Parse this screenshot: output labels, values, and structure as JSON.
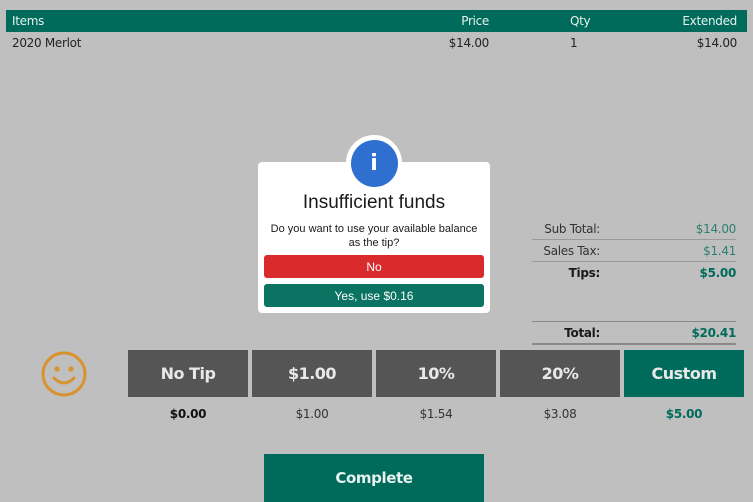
{
  "table": {
    "headers": {
      "items": "Items",
      "price": "Price",
      "qty": "Qty",
      "extended": "Extended"
    },
    "rows": [
      {
        "item": "2020 Merlot",
        "price": "$14.00",
        "qty": "1",
        "extended": "$14.00"
      }
    ]
  },
  "totals": {
    "sub_total_label": "Sub Total:",
    "sub_total": "$14.00",
    "sales_tax_label": "Sales Tax:",
    "sales_tax": "$1.41",
    "tips_label": "Tips:",
    "tips": "$5.00",
    "total_label": "Total:",
    "total": "$20.41"
  },
  "tip_options": [
    {
      "label": "No Tip",
      "amount": "$0.00"
    },
    {
      "label": "$1.00",
      "amount": "$1.00"
    },
    {
      "label": "10%",
      "amount": "$1.54"
    },
    {
      "label": "20%",
      "amount": "$3.08"
    },
    {
      "label": "Custom",
      "amount": "$5.00"
    }
  ],
  "complete_label": "Complete",
  "modal": {
    "icon": "i",
    "title": "Insufficient funds",
    "message": "Do you want to use your available balance as the tip?",
    "no_label": "No",
    "yes_label": "Yes, use $0.16"
  },
  "colors": {
    "accent": "#006b5a",
    "danger": "#d92b2b",
    "info": "#2f6fcf",
    "smiley": "#d9922f"
  }
}
